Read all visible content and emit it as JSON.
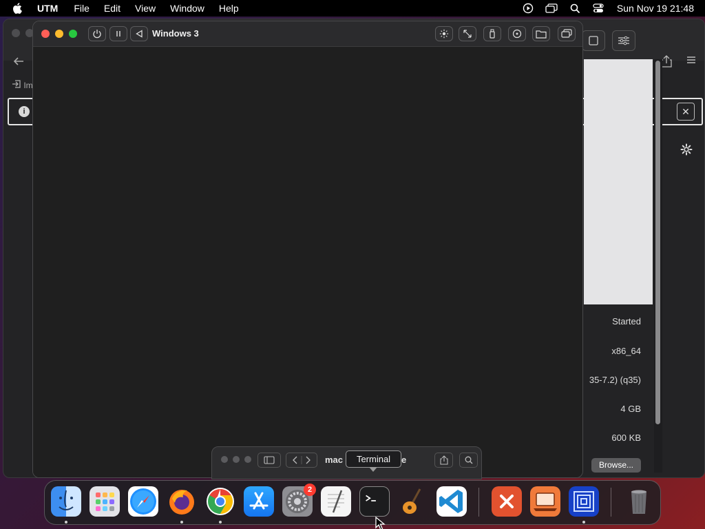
{
  "menubar": {
    "app_name": "UTM",
    "menus": [
      "File",
      "Edit",
      "View",
      "Window",
      "Help"
    ],
    "clock": "Sun Nov 19  21:48",
    "status_icons": [
      "screen-record-icon",
      "screen-mirror-icon",
      "spotlight-search-icon",
      "control-center-icon"
    ]
  },
  "vm_window": {
    "title": "Windows 3",
    "toolbar_left": [
      "power-icon",
      "pause-icon",
      "restart-icon"
    ],
    "toolbar_right": [
      "display-brightness-icon",
      "resize-icon",
      "usb-icon",
      "drive-icon",
      "shared-folder-icon",
      "windows-icon"
    ]
  },
  "manager": {
    "import_label": "Im",
    "details": {
      "status": "Started",
      "architecture": "x86_64",
      "machine": "35-7.2) (q35)",
      "memory": "4 GB",
      "size": "600 KB"
    },
    "browse_label": "Browse..."
  },
  "finder": {
    "title_start": "mac",
    "title_end": "e"
  },
  "tooltip": {
    "text": "Terminal"
  },
  "dock": {
    "items": [
      {
        "name": "Finder",
        "icon": "finder-icon",
        "running": true
      },
      {
        "name": "Launchpad",
        "icon": "launchpad-icon",
        "running": false
      },
      {
        "name": "Safari",
        "icon": "safari-icon",
        "running": false
      },
      {
        "name": "Firefox",
        "icon": "firefox-icon",
        "running": true
      },
      {
        "name": "Chrome",
        "icon": "chrome-icon",
        "running": true
      },
      {
        "name": "App Store",
        "icon": "app-store-icon",
        "running": false
      },
      {
        "name": "System Settings",
        "icon": "system-settings-icon",
        "running": false,
        "badge": "2"
      },
      {
        "name": "TextEdit",
        "icon": "textedit-icon",
        "running": false
      },
      {
        "name": "Terminal",
        "icon": "terminal-icon",
        "running": false
      },
      {
        "name": "GarageBand",
        "icon": "garageband-icon",
        "running": false
      },
      {
        "name": "Visual Studio Code",
        "icon": "vscode-icon",
        "running": false
      },
      {
        "name": "Remote Desktop",
        "icon": "remote-desktop-icon",
        "running": false
      },
      {
        "name": "UTM",
        "icon": "utm-icon",
        "running": false
      },
      {
        "name": "Screen Sharing",
        "icon": "screen-sharing-icon",
        "running": true
      },
      {
        "name": "Trash",
        "icon": "trash-icon",
        "running": false
      }
    ]
  }
}
